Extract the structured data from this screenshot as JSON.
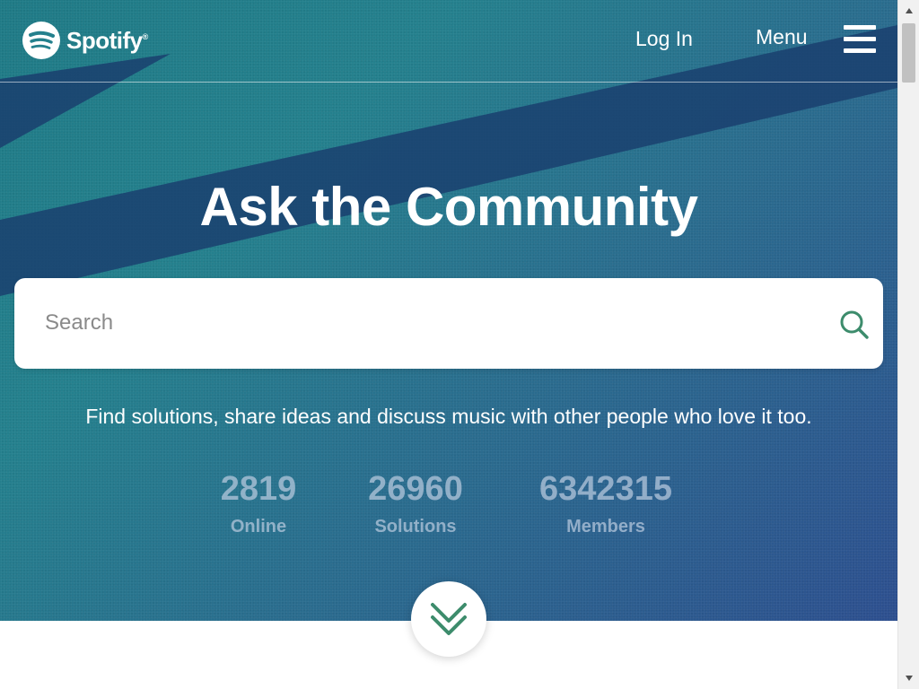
{
  "header": {
    "logo_text": "Spotify",
    "logo_mark": "®",
    "login_label": "Log In",
    "menu_label": "Menu"
  },
  "hero": {
    "title": "Ask the Community",
    "tagline": "Find solutions, share ideas and discuss music with other people who love it too."
  },
  "search": {
    "placeholder": "Search",
    "value": ""
  },
  "stats": [
    {
      "value": "2819",
      "label": "Online"
    },
    {
      "value": "26960",
      "label": "Solutions"
    },
    {
      "value": "6342315",
      "label": "Members"
    }
  ],
  "icons": {
    "logo": "spotify-logo-icon",
    "menu": "hamburger-icon",
    "search": "search-icon",
    "scroll": "chevron-double-down-icon"
  },
  "colors": {
    "accent": "#3d8c6c",
    "hero_start": "#1f7a86",
    "hero_end": "#2d4f8f",
    "stripe": "#1a3f6e"
  }
}
